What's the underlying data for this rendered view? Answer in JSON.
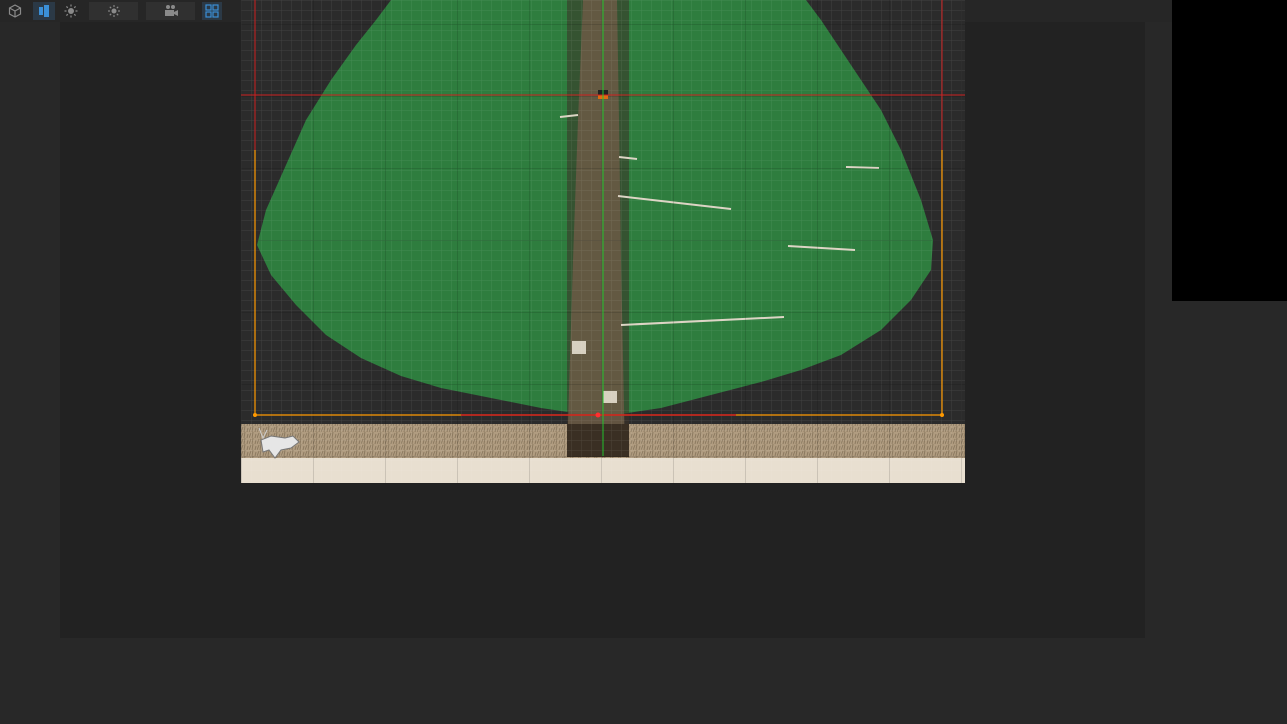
{
  "window": {
    "background": "#282828"
  },
  "toolbar": {
    "buttons": [
      {
        "name": "view-3d-toggle-button",
        "icon": "cube-icon",
        "active": false
      },
      {
        "name": "view-2d-toggle-button",
        "icon": "2d-view-icon",
        "active": true
      },
      {
        "name": "lighting-toggle-button",
        "icon": "sun-icon",
        "active": false
      },
      {
        "name": "scene-lighting-dropdown",
        "icon": "sun-icon",
        "active": false
      },
      {
        "name": "camera-dropdown",
        "icon": "camera-icon",
        "active": false
      },
      {
        "name": "gizmos-toggle-button",
        "icon": "grid-icon",
        "active": true
      }
    ]
  },
  "scene": {
    "colors": {
      "background": "#2b2b2b",
      "foliage": "#2e7d3e",
      "trunk": "#6b5a45",
      "ground_top": "#b09c80",
      "ground_bottom": "#e8dfd0",
      "camera_bounds": "#ff9900",
      "guide_lines": "#cc1f1f",
      "center_line": "#22c22c"
    },
    "sprites": [
      "bird-sprite",
      "dog-sprite",
      "snow-patch",
      "snow-patch"
    ]
  },
  "preview": {
    "background": "#000000"
  }
}
